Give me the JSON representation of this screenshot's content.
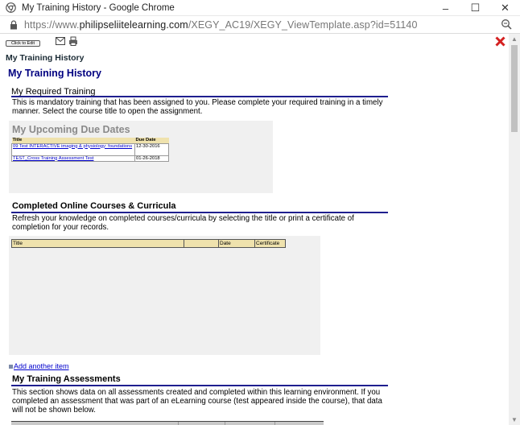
{
  "window": {
    "title": "My Training History - Google Chrome",
    "minimize": "–",
    "maximize": "☐",
    "close": "✕"
  },
  "address": {
    "url_prefix": "https://www.",
    "url_domain": "philipseliitelearning.com",
    "url_path": "/XEGY_AC19/XEGY_ViewTemplate.asp?id=51140"
  },
  "toolbar": {
    "edit_label": "Click to Edit"
  },
  "breadcrumb": "My Training History",
  "page_title": "My Training History",
  "required": {
    "heading": "My Required Training",
    "description": "This is mandatory training that has been assigned to you. Please complete your required training in a timely manner. Select the course title to open the assignment.",
    "due_title": "My Upcoming Due Dates",
    "columns": [
      "Title",
      "Due Date"
    ],
    "rows": [
      {
        "title": "09 Test INTERACTIVE imaging & physiology: foundations",
        "due": "12-30-2016"
      },
      {
        "title": "TEST_Cross Training Assessment Test",
        "due": "01-26-2018"
      }
    ]
  },
  "completed": {
    "heading": "Completed Online Courses & Curricula",
    "description": "Refresh your knowledge on completed courses/curricula by selecting the title or print a certificate of completion for your records.",
    "columns": [
      "Title",
      "",
      "Date",
      "Certificate"
    ]
  },
  "add_item": "Add another item",
  "assessments": {
    "heading": "My Training Assessments",
    "description": "This section shows data on all assessments created and completed within this learning environment. If you completed an assessment that was part of an eLearning course (test appeared inside the course), that data will not be shown below."
  },
  "colors": {
    "accent": "#000080",
    "rule": "#1f1f8f",
    "table_header": "#efe2ad",
    "panel": "#f0f0f0",
    "close_red": "#d42020"
  }
}
